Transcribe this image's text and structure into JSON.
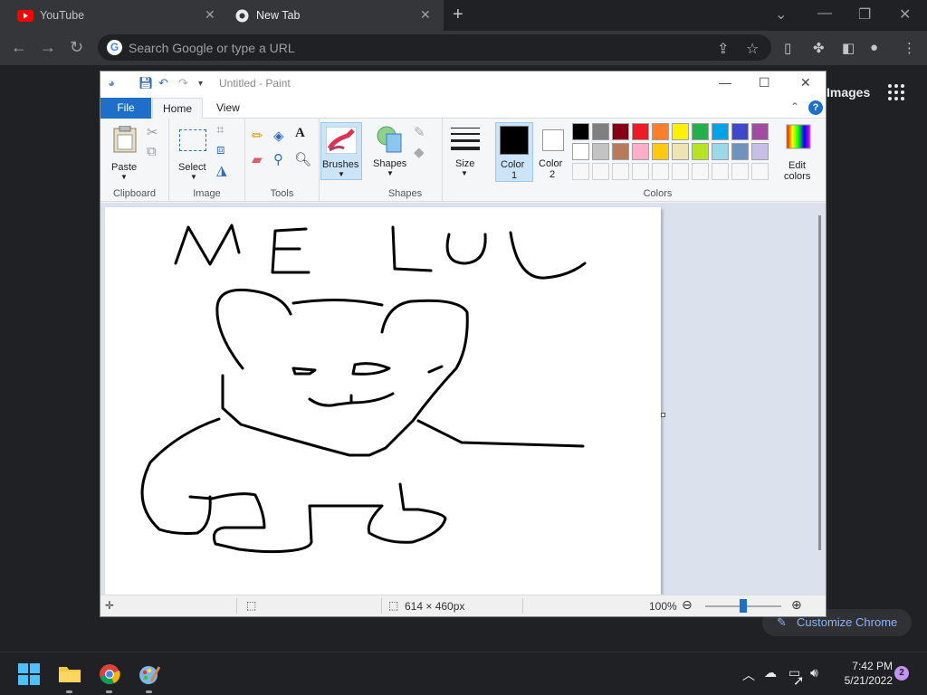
{
  "chrome": {
    "tabs": [
      {
        "title": "YouTube",
        "icon": "youtube-icon"
      },
      {
        "title": "New Tab",
        "icon": "chrome-icon"
      }
    ],
    "omnibox_placeholder": "Search Google or type a URL",
    "ntp": {
      "images_link": "Images",
      "customize_label": "Customize Chrome"
    }
  },
  "paint": {
    "title": "Untitled - Paint",
    "menus": {
      "file": "File",
      "home": "Home",
      "view": "View"
    },
    "help": "?",
    "groups": {
      "clipboard": "Clipboard",
      "image": "Image",
      "tools": "Tools",
      "shapes": "Shapes",
      "colors": "Colors"
    },
    "buttons": {
      "paste": "Paste",
      "select": "Select",
      "brushes": "Brushes",
      "shapes": "Shapes",
      "size": "Size",
      "color1": "Color",
      "color1_num": "1",
      "color2": "Color",
      "color2_num": "2",
      "edit_colors_1": "Edit",
      "edit_colors_2": "colors"
    },
    "palette_row1": [
      "#000000",
      "#7f7f7f",
      "#880015",
      "#ed1c24",
      "#ff7f27",
      "#fff200",
      "#22b14c",
      "#00a2e8",
      "#3f48cc",
      "#a349a4"
    ],
    "palette_row2": [
      "#ffffff",
      "#c3c3c3",
      "#b97a57",
      "#ffaec9",
      "#ffc90e",
      "#efe4b0",
      "#b5e61d",
      "#99d9ea",
      "#7092be",
      "#c8bfe7"
    ],
    "canvas_text": "ME LOL",
    "status": {
      "size": "614 × 460px",
      "zoom": "100%"
    }
  },
  "taskbar": {
    "time": "7:42 PM",
    "date": "5/21/2022",
    "badge": "2"
  }
}
